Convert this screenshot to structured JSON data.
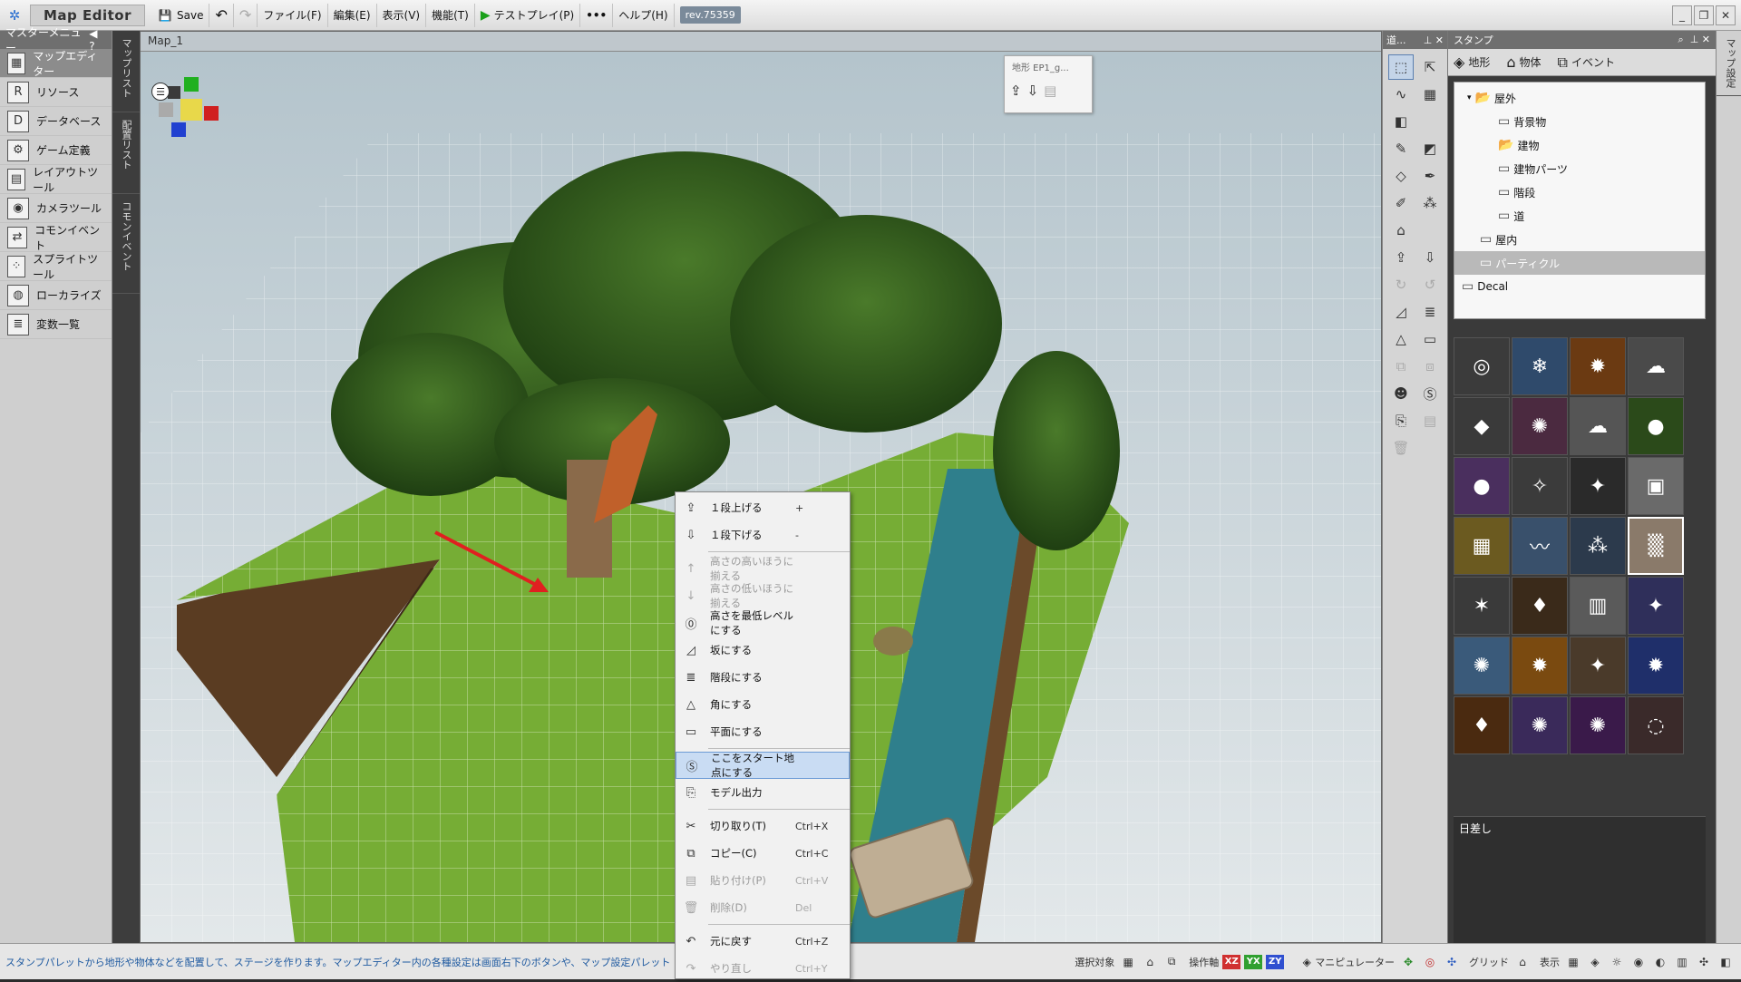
{
  "app": {
    "title": "Map Editor",
    "save_label": "Save",
    "menus": [
      "ファイル(F)",
      "編集(E)",
      "表示(V)",
      "機能(T)"
    ],
    "testplay_label": "テストプレイ(P)",
    "help_label": "ヘルプ(H)",
    "revision": "rev.75359"
  },
  "master_menu": {
    "title": "マスターメニュー",
    "help": "?",
    "items": [
      {
        "label": "マップエディター",
        "icon": "map-editor-icon"
      },
      {
        "label": "リソース",
        "icon": "resource-icon"
      },
      {
        "label": "データベース",
        "icon": "database-icon"
      },
      {
        "label": "ゲーム定義",
        "icon": "game-definition-icon"
      },
      {
        "label": "レイアウトツール",
        "icon": "layout-tool-icon"
      },
      {
        "label": "カメラツール",
        "icon": "camera-tool-icon"
      },
      {
        "label": "コモンイベント",
        "icon": "common-event-icon"
      },
      {
        "label": "スプライトツール",
        "icon": "sprite-tool-icon"
      },
      {
        "label": "ローカライズ",
        "icon": "localize-icon"
      },
      {
        "label": "変数一覧",
        "icon": "variable-list-icon"
      }
    ]
  },
  "side_tabs": [
    "マップリスト",
    "配置リスト",
    "コモンイベント"
  ],
  "viewport": {
    "tab": "Map_1",
    "terrain_popup_title": "地形 EP1_g..."
  },
  "context_menu": {
    "items": [
      {
        "label": "１段上げる",
        "shortcut": "+",
        "icon": "raise-icon",
        "enabled": true
      },
      {
        "label": "１段下げる",
        "shortcut": "-",
        "icon": "lower-icon",
        "enabled": true
      },
      {
        "sep": true
      },
      {
        "label": "高さの高いほうに揃える",
        "shortcut": "",
        "icon": "align-high-icon",
        "enabled": false
      },
      {
        "label": "高さの低いほうに揃える",
        "shortcut": "",
        "icon": "align-low-icon",
        "enabled": false
      },
      {
        "label": "高さを最低レベルにする",
        "shortcut": "",
        "icon": "lowest-level-icon",
        "enabled": true
      },
      {
        "label": "坂にする",
        "shortcut": "",
        "icon": "slope-icon",
        "enabled": true
      },
      {
        "label": "階段にする",
        "shortcut": "",
        "icon": "stairs-icon",
        "enabled": true
      },
      {
        "label": "角にする",
        "shortcut": "",
        "icon": "corner-icon",
        "enabled": true
      },
      {
        "label": "平面にする",
        "shortcut": "",
        "icon": "flat-icon",
        "enabled": true
      },
      {
        "sep": true
      },
      {
        "label": "ここをスタート地点にする",
        "shortcut": "",
        "icon": "start-point-icon",
        "enabled": true,
        "highlight": true
      },
      {
        "label": "モデル出力",
        "shortcut": "",
        "icon": "model-export-icon",
        "enabled": true
      },
      {
        "sep": true
      },
      {
        "label": "切り取り(T)",
        "shortcut": "Ctrl+X",
        "icon": "cut-icon",
        "enabled": true
      },
      {
        "label": "コピー(C)",
        "shortcut": "Ctrl+C",
        "icon": "copy-icon",
        "enabled": true
      },
      {
        "label": "貼り付け(P)",
        "shortcut": "Ctrl+V",
        "icon": "paste-icon",
        "enabled": false
      },
      {
        "label": "削除(D)",
        "shortcut": "Del",
        "icon": "delete-icon",
        "enabled": false
      },
      {
        "sep": true
      },
      {
        "label": "元に戻す",
        "shortcut": "Ctrl+Z",
        "icon": "undo-icon",
        "enabled": true
      },
      {
        "label": "やり直し",
        "shortcut": "Ctrl+Y",
        "icon": "redo-icon",
        "enabled": false
      }
    ]
  },
  "tool_column": {
    "title": "道...",
    "tools": [
      "select-rect-icon",
      "select-arrow-icon",
      "lasso-icon",
      "grid-icon",
      "terrain-cube-icon",
      "blank",
      "pencil-icon",
      "bucket-icon",
      "eraser-icon",
      "eyedropper-icon",
      "brush-icon",
      "spray-icon",
      "house-icon",
      "blank",
      "raise-tool-icon",
      "lower-tool-icon",
      "rotate-icon",
      "rotate2-icon",
      "slope-tool-icon",
      "stairs-tool-icon",
      "corner-tool-icon",
      "flat-tool-icon",
      "copy-tool-icon",
      "paste-tool-icon",
      "character-icon",
      "start-icon",
      "export-tool-icon",
      "clipboard-icon",
      "trash-icon",
      "blank"
    ]
  },
  "stamp_panel": {
    "title": "スタンプ",
    "tabs": [
      {
        "label": "地形",
        "icon": "terrain-tab-icon"
      },
      {
        "label": "物体",
        "icon": "object-tab-icon"
      },
      {
        "label": "イベント",
        "icon": "event-tab-icon"
      }
    ],
    "tree": [
      {
        "label": "屋外",
        "level": 1,
        "open": true
      },
      {
        "label": "背景物",
        "level": 2
      },
      {
        "label": "建物",
        "level": 2,
        "open": true
      },
      {
        "label": "建物パーツ",
        "level": 2
      },
      {
        "label": "階段",
        "level": 2
      },
      {
        "label": "道",
        "level": 2
      },
      {
        "label": "屋内",
        "level": 1
      },
      {
        "label": "パーティクル",
        "level": 1,
        "selected": true
      },
      {
        "label": "Decal",
        "level": 0
      }
    ],
    "selected_name": "日差し",
    "thumb_colors": [
      "#3b3b3b",
      "#2f4a6b",
      "#6b3a12",
      "#4a4a4a",
      "#3a3a3a",
      "#4b2a40",
      "#555555",
      "#2b4a1a",
      "#4a2f5e",
      "#3b3b3b",
      "#2a2a2a",
      "#6a6a6a",
      "#6b5a20",
      "#39506b",
      "#2c3a4c",
      "#8a7a6a",
      "#3a3a3a",
      "#3a2a1a",
      "#5a5a5a",
      "#2f2f5a",
      "#3a5a7a",
      "#7a4a10",
      "#4a3a2a",
      "#1f2f6a",
      "#4a2a10",
      "#3a2a5a",
      "#3a1a4a",
      "#3a2a2a"
    ]
  },
  "status": {
    "message": "スタンプパレットから地形や物体などを配置して、ステージを作ります。マップエディター内の各種設定は画面右下のボタンや、マップ設定パレットの作",
    "select_target": "選択対象",
    "operation_axis": "操作軸",
    "axes": [
      "XZ",
      "YX",
      "ZY"
    ],
    "manipulator": "マニピュレーター",
    "grid": "グリッド",
    "display": "表示"
  },
  "colors": {
    "accent": "#6c9bd6",
    "grass": "#7fb23a",
    "water": "#2f7f8c",
    "tree": "#2d5a1c",
    "soil": "#5a3c22",
    "arrow": "#e02020"
  }
}
